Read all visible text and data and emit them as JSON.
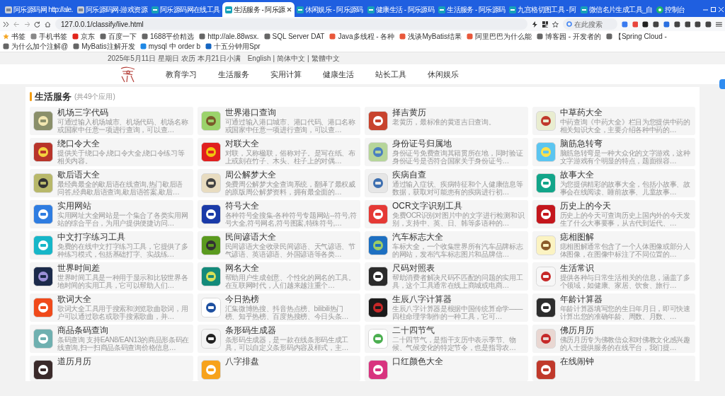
{
  "browser": {
    "tabs": [
      {
        "title": "阿乐源码网 http://ale.",
        "kind": "site",
        "selected": false
      },
      {
        "title": "阿乐源码网-游戏资源",
        "kind": "site",
        "selected": false
      },
      {
        "title": "阿乐源码网在线工具",
        "kind": "ke",
        "selected": false
      },
      {
        "title": "生活服务 - 阿乐源",
        "kind": "ke",
        "selected": true
      },
      {
        "title": "休闲娱乐 - 阿乐源码",
        "kind": "ke",
        "selected": false
      },
      {
        "title": "健康生活 - 阿乐源码",
        "kind": "ke",
        "selected": false
      },
      {
        "title": "生活服务 - 阿乐源码",
        "kind": "ke",
        "selected": false
      },
      {
        "title": "九宫格切图工具 - 阿",
        "kind": "ke",
        "selected": false
      },
      {
        "title": "微信名片生成工具_自",
        "kind": "ke",
        "selected": false
      },
      {
        "title": "控制台",
        "kind": "console",
        "selected": false
      }
    ],
    "address": "127.0.0.1/classify/live.html",
    "search_placeholder": "在此搜索",
    "bookmarks": [
      "书签",
      "手机书签",
      "京东",
      "百度一下",
      "1688平价精选",
      "http://ale.88wsx.",
      "SQL Server DAT",
      "Java多线程 - 各种",
      "浅谈MyBatis结果",
      "阿里巴巴为什么能",
      "博客园 - 开发者的",
      "【Spring Cloud -",
      "为什么加个注解@",
      "MyBatis注解开发",
      "mysql 中 order b",
      "十五分钟用Spr"
    ]
  },
  "page": {
    "date_line": "2025年5月11日 星期日 农历 本月21日小满",
    "languages": [
      "English",
      "简体中文",
      "繁體中文"
    ],
    "language_separator": "|",
    "nav": [
      "教育学习",
      "生活服务",
      "实用计算",
      "健康生活",
      "站长工具",
      "休闲娱乐"
    ],
    "section": {
      "title": "生活服务",
      "count": "(共49个应用)"
    },
    "apps": [
      {
        "title": "机场三字代码",
        "description": "可通过输入机场城市、机场代码、机场名称或国家中任意一项进行查询，可以查…"
      },
      {
        "title": "世界港口查询",
        "description": "可通过输入港口城市、港口代码、港口名称或国家中任意一项进行查询，可以查…"
      },
      {
        "title": "择吉黄历",
        "description": "老黄历，最标准的黄道吉日查询。"
      },
      {
        "title": "中草药大全",
        "description": "中药查询《中药大全》栏目为您提供中药的相关知识大全，主要介绍各种中药的…"
      },
      {
        "title": "绕口令大全",
        "description": "提供关于绕口令,绕口令大全,绕口令练习等相关内容。"
      },
      {
        "title": "对联大全",
        "description": "对联，又称楹联，俗称对子。是写在纸、布上或刻在竹子、木头、柱子上的对偶…"
      },
      {
        "title": "身份证号归属地",
        "description": "身份证号免费查询其籍贯所在地，同时验证身份证号是否符合国家关于身份证号…"
      },
      {
        "title": "脑筋急转弯",
        "description": "脑筋急转弯是一种大众化的文字游戏，这种文字游戏有个明显的特点，题面很容…"
      },
      {
        "title": "歇后语大全",
        "description": "最经典最全的歇后语在线查询,热门歇后语问答,经典歇后语查询,歇后语答案,歇后…"
      },
      {
        "title": "周公解梦大全",
        "description": "免费周公解梦大全查询系统，翻译了最权威的原版周公解梦资料，拥有最全面的…"
      },
      {
        "title": "疾病自查",
        "description": "通过输入症状、疾病特征和个人健康信息等数据，获取对可能患有的疾病进行初…"
      },
      {
        "title": "故事大全",
        "description": "为您提供精彩的故事大全，包括小故事、故事会在线阅读、睡前故事、儿童故事…"
      },
      {
        "title": "实用网站",
        "description": "实用网址大全网站是一个集合了各类实用网站的综合平台，为用户提供便捷访问…"
      },
      {
        "title": "符号大全",
        "description": "各种符号全搜集-各种符号专题网站--符号,符号大全,符号网名,符号图案,特殊符号,…"
      },
      {
        "title": "OCR文字识别工具",
        "description": "免费OCR识别对图片中的文字进行检测和识别，支持中、英、日、韩等多语种的…"
      },
      {
        "title": "历史上的今天",
        "description": "历史上的今天可查询历史上国内外的今天发生了什么大事要事，从古代到近代、…"
      },
      {
        "title": "中文打字练习工具",
        "description": "免费的在线中文打字练习工具，它提供了多种练习模式，包括基础打字、实战练…"
      },
      {
        "title": "民间谚语大全",
        "description": "民间谚语大全收录民间谚语、天气谚语、节气谚语、英语谚语、外国谚语等各类…"
      },
      {
        "title": "汽车标志大全",
        "description": "车标大全，一个收集世界所有汽车品牌标志的网站，发布汽车标志图片和品牌信…"
      },
      {
        "title": "痣相图解",
        "description": "痣相图解通常包含了一个人体图像或部分人体图像，在图像中标注了不同位置的…"
      },
      {
        "title": "世界时间差",
        "description": "世界时间工具是一种用于显示和比较世界各地时间的实用工具，它可以帮助人们…"
      },
      {
        "title": "网名大全",
        "description": "帮助用户生成创意、个性化的网名的工具。在互联网时代，人们越来越注重个…"
      },
      {
        "title": "尺码对照表",
        "description": "帮助消费者解决尺码不匹配的问题的实用工具，这个工具通常在线上商城或电商…"
      },
      {
        "title": "生活常识",
        "description": "提供各种与日常生活相关的信息，涵盖了多个领域，如健康、家居、饮食、旅行…"
      },
      {
        "title": "歌词大全",
        "description": "歌词大全工具用于搜索和浏览歌曲歌词，用户可以通过歌名或歌手搜索歌曲，并…"
      },
      {
        "title": "今日热榜",
        "description": "汇集微博热搜、抖音热点榜、bilibili热门榜、知乎热榜、百度热搜榜、今日头条…"
      },
      {
        "title": "生辰八字计算器",
        "description": "生辰八字计算器是根据中国传统算命学——四柱命理学制作的一种工具，它可…"
      },
      {
        "title": "年龄计算器",
        "description": "年龄计算器填写您的生日年月日，即可快速计算出您的准确年龄、周数、月数、…"
      },
      {
        "title": "商品条码查询",
        "description": "条码查询 支持EAN8/EAN13的商品形条码在线查询,扫一扫商品条码查询价格信息…"
      },
      {
        "title": "条形码生成器",
        "description": "条形码生成器，是一款在线条形码生成工具，可以自定义条形码内容及样式，主…"
      },
      {
        "title": "二十四节气",
        "description": "二十四节气，是指干支历中表示季节、物候、气候变化的特定节令，也是指导农…"
      },
      {
        "title": "佛历月历",
        "description": "佛历月历专为佛教信众和对佛教文化感兴趣的人士提供服务的在线平台，我们提…"
      },
      {
        "title": "道历月历"
      },
      {
        "title": "八字排盘"
      },
      {
        "title": "口红颜色大全"
      },
      {
        "title": "在线闹钟"
      }
    ]
  }
}
